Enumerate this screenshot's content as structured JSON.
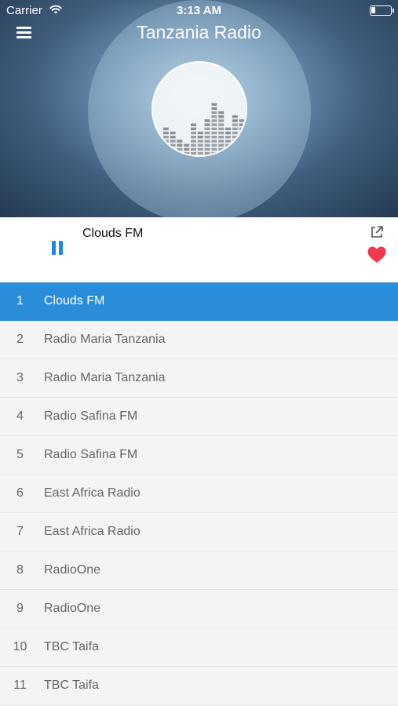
{
  "status_bar": {
    "carrier": "Carrier",
    "time": "3:13 AM",
    "wifi_icon": "wifi-icon",
    "battery_icon": "battery-icon"
  },
  "header": {
    "title": "Tanzania Radio",
    "menu_icon": "hamburger-menu-icon",
    "logo_icon": "equalizer-icon",
    "background_color": "#3f5e7d"
  },
  "player": {
    "now_playing": "Clouds FM",
    "state": "playing",
    "pause_icon": "pause-icon",
    "share_icon": "external-share-icon",
    "favorite_icon": "heart-icon",
    "accent_color": "#1e88e5",
    "heart_color": "#f0384f"
  },
  "stations": [
    {
      "num": "1",
      "name": "Clouds FM"
    },
    {
      "num": "2",
      "name": "Radio Maria Tanzania"
    },
    {
      "num": "3",
      "name": "Radio Maria Tanzania"
    },
    {
      "num": "4",
      "name": "Radio Safina FM"
    },
    {
      "num": "5",
      "name": "Radio Safina FM"
    },
    {
      "num": "6",
      "name": "East Africa Radio"
    },
    {
      "num": "7",
      "name": "East Africa Radio"
    },
    {
      "num": "8",
      "name": "RadioOne"
    },
    {
      "num": "9",
      "name": "RadioOne"
    },
    {
      "num": "10",
      "name": "TBC Taifa"
    },
    {
      "num": "11",
      "name": "TBC Taifa"
    }
  ],
  "selected_station_index": 0,
  "selected_color": "#2a8ddb"
}
